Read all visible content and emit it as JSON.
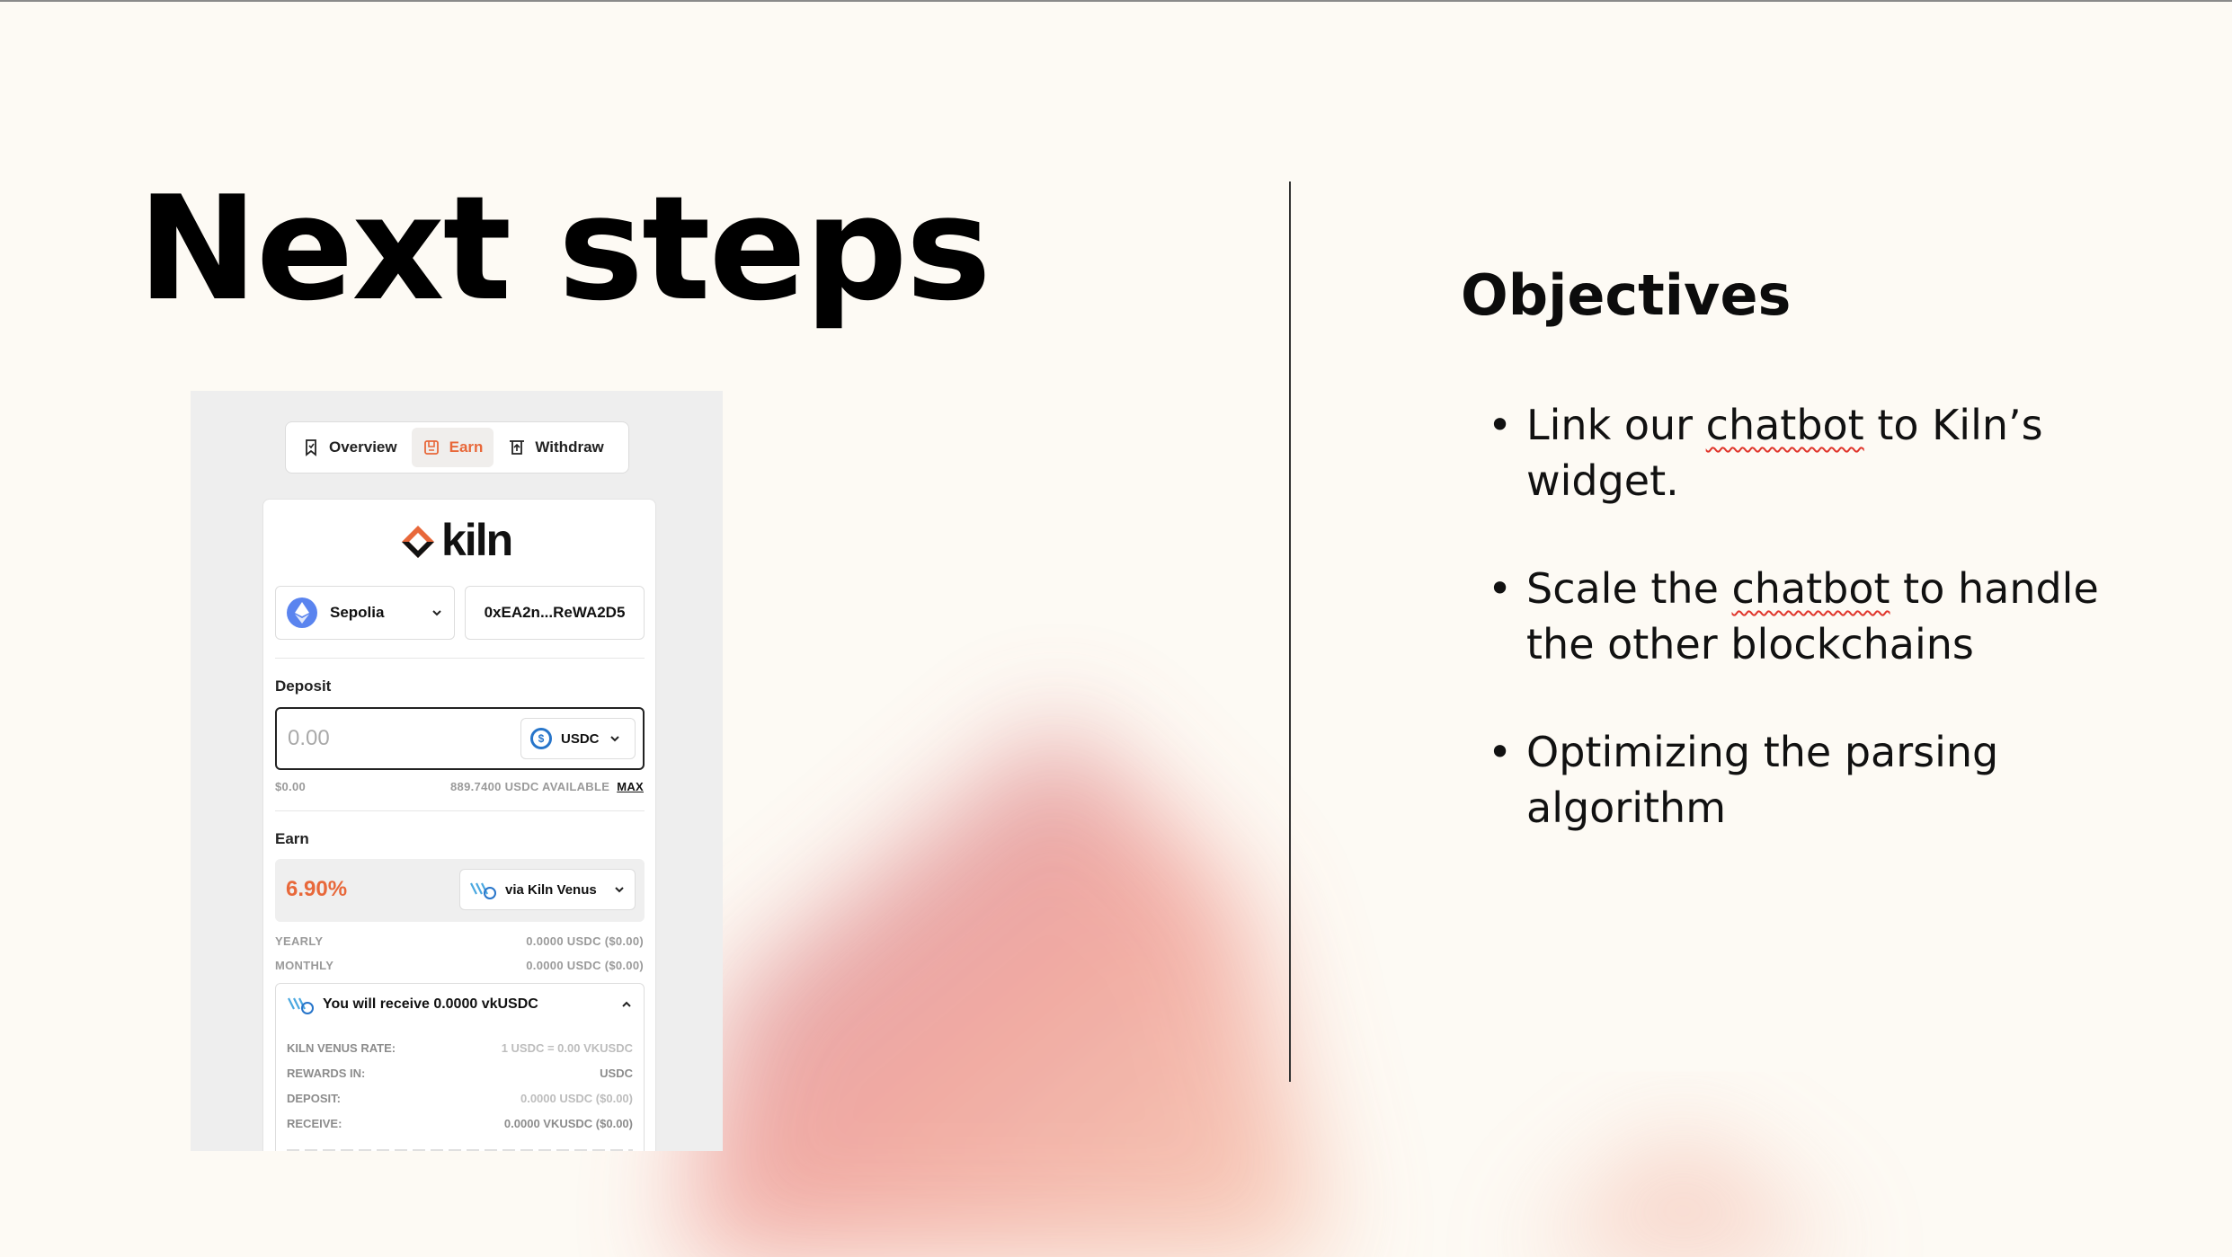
{
  "slide": {
    "title": "Next steps",
    "objectives_heading": "Objectives",
    "objectives": [
      {
        "before": "Link our ",
        "underlined": "chatbot",
        "after": " to Kiln’s widget."
      },
      {
        "before": "Scale the ",
        "underlined": "chatbot",
        "after": " to handle the other blockchains"
      },
      {
        "before": "",
        "underlined": "",
        "after": "Optimizing the parsing algorithm"
      }
    ]
  },
  "widget": {
    "tabs": [
      {
        "label": "Overview",
        "icon": "bookmark-icon",
        "active": false
      },
      {
        "label": "Earn",
        "icon": "earn-icon",
        "active": true
      },
      {
        "label": "Withdraw",
        "icon": "withdraw-icon",
        "active": false
      }
    ],
    "logo_text": "kiln",
    "network": {
      "label": "Sepolia",
      "icon": "ethereum-icon"
    },
    "address": "0xEA2n...ReWA2D5",
    "deposit": {
      "label": "Deposit",
      "amount": "0.00",
      "token": "USDC",
      "usd_value": "$0.00",
      "available": "889.7400 USDC AVAILABLE",
      "max_label": "MAX"
    },
    "earn": {
      "label": "Earn",
      "apy": "6.90%",
      "vault": "via Kiln Venus",
      "yearly_label": "YEARLY",
      "yearly_value": "0.0000 USDC ($0.00)",
      "monthly_label": "MONTHLY",
      "monthly_value": "0.0000 USDC ($0.00)"
    },
    "receive": {
      "heading": "You will receive 0.0000 vkUSDC",
      "rows": [
        {
          "label": "KILN VENUS RATE:",
          "value": "1 USDC = 0.00 VKUSDC"
        },
        {
          "label": "REWARDS IN:",
          "value": "USDC"
        },
        {
          "label": "DEPOSIT:",
          "value": "0.0000 USDC ($0.00)"
        },
        {
          "label": "RECEIVE:",
          "value": "0.0000 VKUSDC ($0.00)"
        }
      ]
    }
  },
  "colors": {
    "background": "#fdfaf4",
    "accent_orange": "#e8683a",
    "spellcheck_red": "#e0352b",
    "usdc_blue": "#2775ca",
    "ethereum_blue": "#5a84ef"
  }
}
